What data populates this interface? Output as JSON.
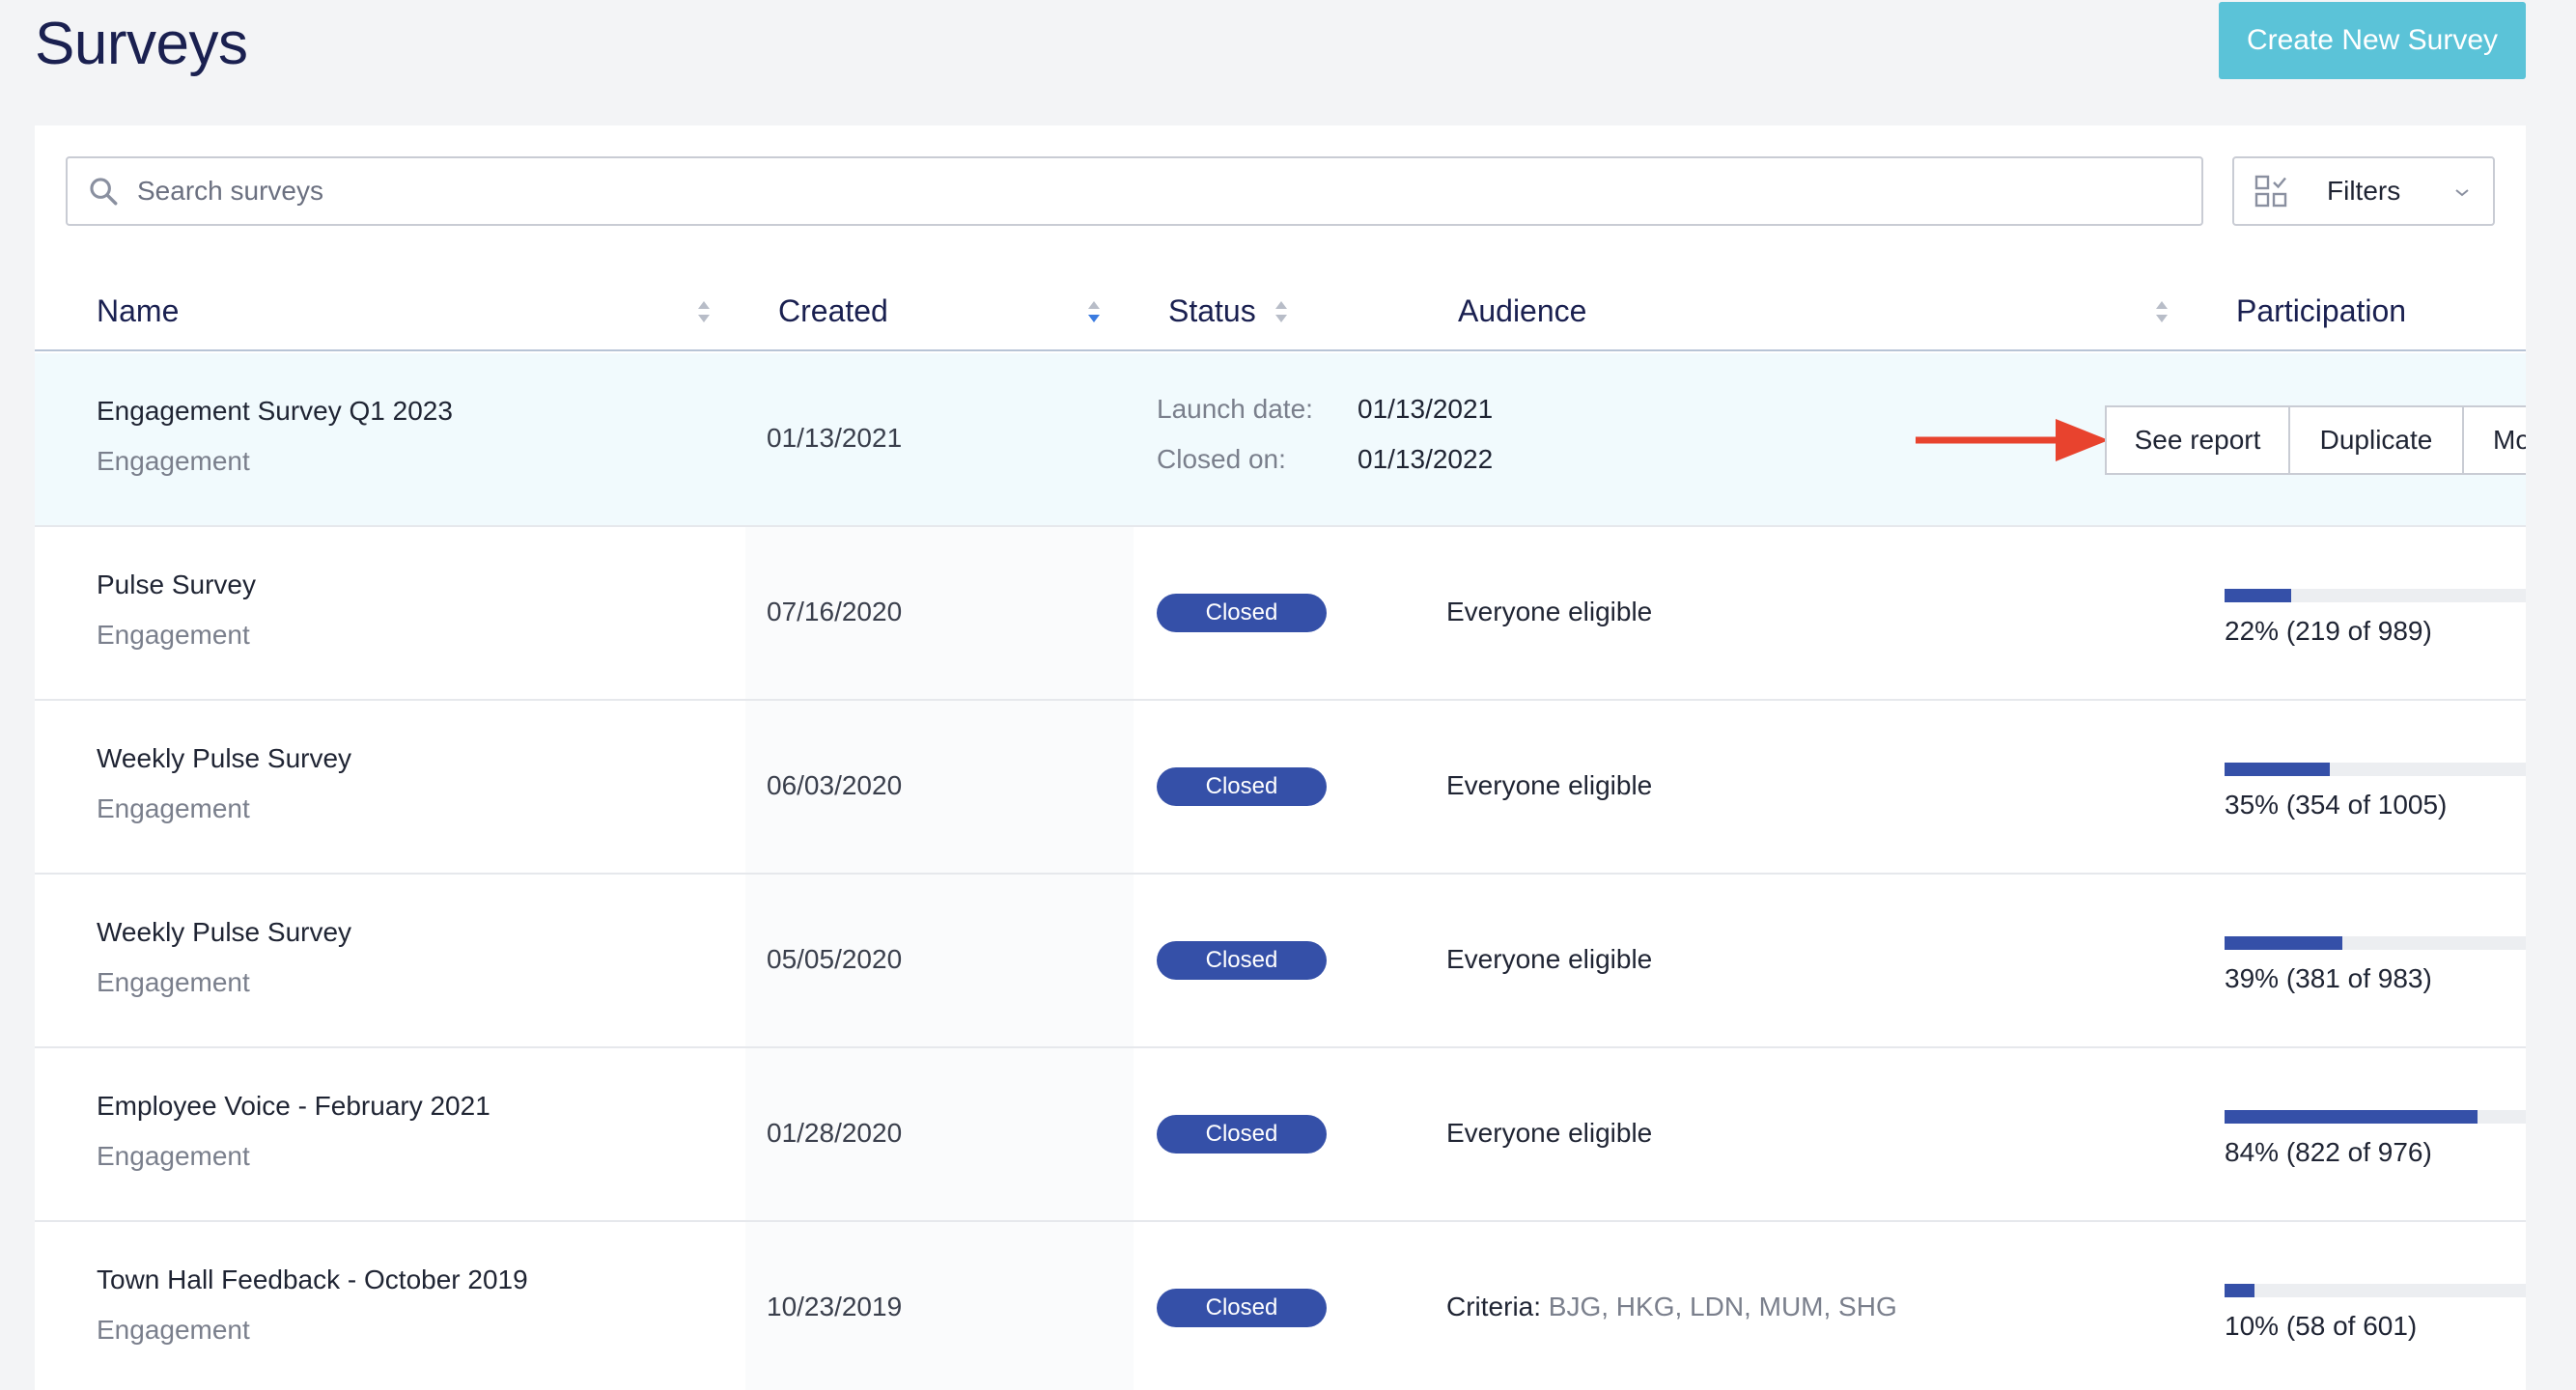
{
  "page": {
    "title": "Surveys",
    "create_button": "Create New Survey"
  },
  "search": {
    "placeholder": "Search surveys"
  },
  "filters": {
    "label": "Filters"
  },
  "columns": {
    "name": "Name",
    "created": "Created",
    "status": "Status",
    "audience": "Audience",
    "participation": "Participation"
  },
  "highlight_row": {
    "name": "Engagement Survey Q1 2023",
    "category": "Engagement",
    "created": "01/13/2021",
    "launch_label": "Launch date:",
    "launch_value": "01/13/2021",
    "closed_label": "Closed on:",
    "closed_value": "01/13/2022",
    "actions": [
      "See report",
      "Duplicate",
      "Mo"
    ]
  },
  "rows": [
    {
      "name": "Pulse Survey",
      "category": "Engagement",
      "created": "07/16/2020",
      "status": "Closed",
      "audience": "Everyone eligible",
      "participation_text": "22% (219 of 989)",
      "participation": 0.22
    },
    {
      "name": "Weekly Pulse Survey",
      "category": "Engagement",
      "created": "06/03/2020",
      "status": "Closed",
      "audience": "Everyone eligible",
      "participation_text": "35% (354 of 1005)",
      "participation": 0.35
    },
    {
      "name": "Weekly Pulse Survey",
      "category": "Engagement",
      "created": "05/05/2020",
      "status": "Closed",
      "audience": "Everyone eligible",
      "participation_text": "39% (381 of 983)",
      "participation": 0.39
    },
    {
      "name": "Employee Voice - February 2021",
      "category": "Engagement",
      "created": "01/28/2020",
      "status": "Closed",
      "audience": "Everyone eligible",
      "participation_text": "84% (822 of 976)",
      "participation": 0.84
    },
    {
      "name": "Town Hall Feedback - October 2019",
      "category": "Engagement",
      "created": "10/23/2019",
      "status": "Closed",
      "audience_label": "Criteria:",
      "audience_value": "BJG, HKG, LDN, MUM, SHG",
      "participation_text": "10% (58 of 601)",
      "participation": 0.1
    }
  ],
  "colors": {
    "accent": "#5bc3d8",
    "badge": "#3550a8",
    "arrow": "#e8432e"
  }
}
